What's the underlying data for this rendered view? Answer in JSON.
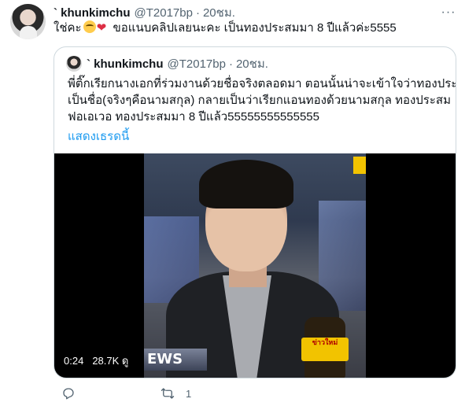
{
  "tweet": {
    "author": {
      "name": "` khunkimchu",
      "handle": "@T2017bp",
      "separator": "·",
      "time": "20ชม."
    },
    "text_before": "ใช่คะ",
    "text_after": "ขอแนบคลิปเลยนะคะ เป็นทองประสมมา 8 ปีแล้วค่ะ5555",
    "emojis": [
      "smiling-face-emoji",
      "heart-emoji"
    ],
    "more_icon": "ellipsis-icon",
    "quote": {
      "author": {
        "name": "` khunkimchu",
        "handle": "@T2017bp",
        "separator": "·",
        "time": "20ชม."
      },
      "text_lines": [
        "พี่ติ๊กเรียกนางเอกที่ร่วมงานด้วยชื่อจริงตลอดมา ตอนนั้นน่าจะเข้าใจว่าทองประสม",
        "เป็นชื่อ(จริงๆคือนามสกุล) กลายเป็นว่าเรียกแอนทองด้วยนามสกุล ทองประสม",
        "ฟอเอเวอ ทองประสมมา 8 ปีแล้ว55555555555555"
      ],
      "show_thread": "แสดงเธรดนี้",
      "video": {
        "duration": "0:24",
        "views": "28.7K ดู",
        "overlay_text": "EWS",
        "mic_label": "ข่าวใหม่"
      }
    },
    "actions": {
      "reply_icon": "reply-icon",
      "retweet_icon": "retweet-icon",
      "retweet_count": "1"
    }
  }
}
